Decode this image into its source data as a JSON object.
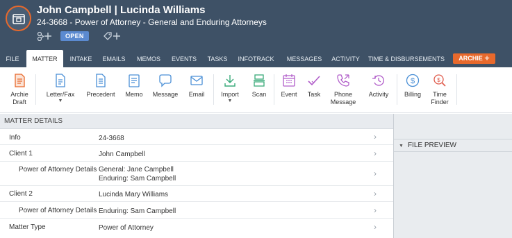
{
  "header": {
    "title": "John Campbell | Lucinda Williams",
    "subtitle": "24-3668 - Power of Attorney - General and Enduring Attorneys",
    "status_badge": "OPEN",
    "icons": [
      "matter-folder-icon",
      "link-add-icon",
      "tag-add-icon"
    ]
  },
  "tabs": [
    "FILE",
    "MATTER",
    "INTAKE",
    "EMAILS",
    "MEMOS",
    "EVENTS",
    "TASKS",
    "INFOTRACK",
    "MESSAGES",
    "ACTIVITY",
    "TIME & DISBURSEMENTS"
  ],
  "active_tab": "MATTER",
  "archie_label": "ARCHIE ✧",
  "toolbar": {
    "archie_draft": "Archie\nDraft",
    "letter_fax": "Letter/Fax",
    "precedent": "Precedent",
    "memo": "Memo",
    "message": "Message",
    "email": "Email",
    "import": "Import",
    "scan": "Scan",
    "event": "Event",
    "task": "Task",
    "phone_message": "Phone\nMessage",
    "activity": "Activity",
    "billing": "Billing",
    "time_finder": "Time\nFinder"
  },
  "matter_details": {
    "heading": "MATTER DETAILS",
    "rows": [
      {
        "label": "Info",
        "value": "24-3668"
      },
      {
        "label": "Client 1",
        "value": "John Campbell"
      },
      {
        "label": "Power of Attorney Details",
        "value": "General: Jane Campbell\nEnduring: Sam Campbell"
      },
      {
        "label": "Client 2",
        "value": "Lucinda Mary Williams"
      },
      {
        "label": "Power of Attorney Details",
        "value": "Enduring: Sam Campbell"
      },
      {
        "label": "Matter Type",
        "value": "Power of Attorney"
      }
    ]
  },
  "file_preview": {
    "heading": "FILE PREVIEW"
  },
  "colors": {
    "header_bg": "#3e5166",
    "accent_orange": "#e8692c",
    "badge_blue": "#5b8ad0"
  }
}
